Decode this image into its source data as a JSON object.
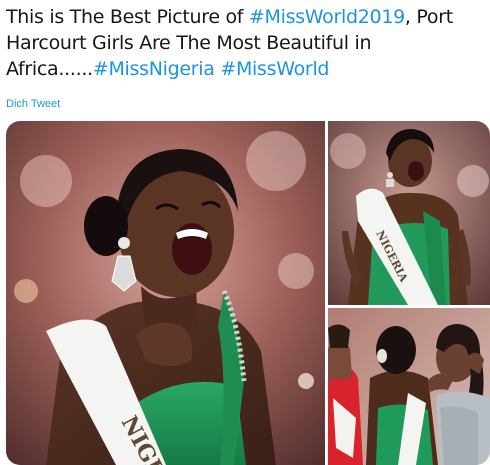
{
  "tweet": {
    "segments": [
      {
        "text": "This is The Best Picture of ",
        "type": "text"
      },
      {
        "text": "#MissWorld2019",
        "type": "hashtag"
      },
      {
        "text": ", Port Harcourt Girls Are The Most Beautiful in Africa......",
        "type": "text"
      },
      {
        "text": "#MissNigeria",
        "type": "hashtag"
      },
      {
        "text": " ",
        "type": "text"
      },
      {
        "text": "#MissWorld",
        "type": "hashtag"
      }
    ],
    "translate_label": "Dich Tweet"
  },
  "media": {
    "sash_text_main": "NIGE",
    "sash_text_top": "NIGERIA",
    "colors": {
      "hashtag": "#1b95e0",
      "dress_green": "#1f9a5a",
      "sash_white": "#f4f4f2",
      "red_dress": "#d8222c"
    }
  }
}
